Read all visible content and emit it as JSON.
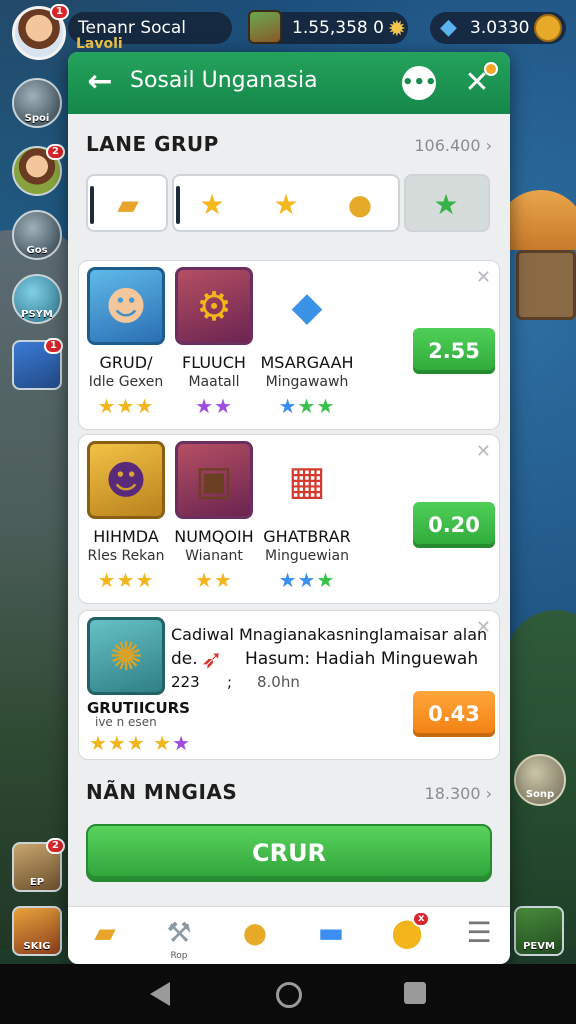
{
  "hud": {
    "player_name": "Tenanr Socal",
    "player_sub": "Lavoli",
    "avatar_badge": "1",
    "resource_1": "1.55,358 0",
    "resource_2": "3.0330"
  },
  "left_menu": [
    {
      "label": "Spoi",
      "badge": ""
    },
    {
      "label": "",
      "badge": "2"
    },
    {
      "label": "Gos",
      "badge": ""
    },
    {
      "label": "PSYM",
      "badge": ""
    },
    {
      "label": "",
      "badge": "1"
    }
  ],
  "panel": {
    "title": "Sosail Unganasia",
    "section1": {
      "title": "LANE GRUP",
      "value": "106.400"
    },
    "section2": {
      "title": "NÃN MNGIAS",
      "value": "18.300"
    },
    "cta_label": "CRUR"
  },
  "offers": [
    {
      "items": [
        {
          "name": "GRUD/",
          "sub": "Idle Gexen",
          "stars": [
            [
              "gold",
              3
            ]
          ]
        },
        {
          "name": "FLUUCH",
          "sub": "Maatall",
          "stars": [
            [
              "purple",
              2
            ]
          ]
        },
        {
          "name": "MSARGAAH",
          "sub": "Mingawawh",
          "stars": [
            [
              "blue",
              1
            ],
            [
              "green",
              2
            ]
          ]
        }
      ],
      "price": "2.55"
    },
    {
      "items": [
        {
          "name": "HIHMDA",
          "sub": "Rles Rekan",
          "stars": [
            [
              "gold",
              3
            ]
          ]
        },
        {
          "name": "NUMQOIH",
          "sub": "Wianant",
          "stars": [
            [
              "gold",
              2
            ]
          ]
        },
        {
          "name": "GHATBRAR",
          "sub": "Minguewian",
          "stars": [
            [
              "blue",
              2
            ],
            [
              "green",
              1
            ]
          ]
        }
      ],
      "price": "0.20"
    }
  ],
  "special_offer": {
    "line1": "Cadiwal Mnagianakasninglamaisar alan",
    "line2_prefix": "de.",
    "line2_text": "Hasum: Hadiah Minguewah",
    "line3_num": "223",
    "line3_sep": ";",
    "line3_time": "8.0hn",
    "item_name": "GRUTIICURS",
    "item_sub": "ive n esen",
    "price": "0.43"
  },
  "bottom_bar": [
    "",
    "Rop",
    "",
    "",
    "",
    ""
  ],
  "right_side": {
    "label": "Sonp"
  },
  "left_bottom": [
    {
      "label": "EP",
      "badge": "2"
    },
    {
      "label": "SKIG",
      "badge": ""
    }
  ],
  "right_bottom": {
    "label": "PEVM"
  },
  "colors": {
    "header_green": "#1d9553",
    "price_green": "#3ebd48",
    "price_orange": "#f6901f",
    "badge_red": "#d9262c"
  }
}
